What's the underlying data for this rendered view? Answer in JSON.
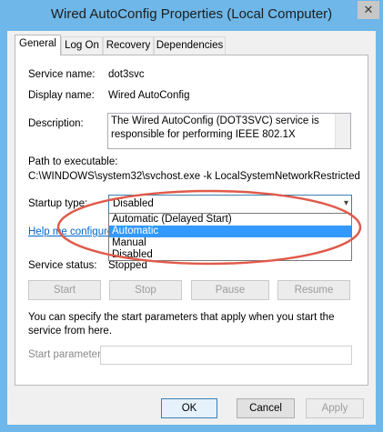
{
  "window": {
    "title": "Wired AutoConfig Properties (Local Computer)",
    "close_icon": "close-icon"
  },
  "tabs": [
    {
      "label": "General"
    },
    {
      "label": "Log On"
    },
    {
      "label": "Recovery"
    },
    {
      "label": "Dependencies"
    }
  ],
  "general": {
    "service_name_label": "Service name:",
    "service_name_value": "dot3svc",
    "display_name_label": "Display name:",
    "display_name_value": "Wired AutoConfig",
    "description_label": "Description:",
    "description_value": "The Wired AutoConfig (DOT3SVC) service is responsible for performing IEEE 802.1X",
    "path_label": "Path to executable:",
    "path_value": "C:\\WINDOWS\\system32\\svchost.exe -k LocalSystemNetworkRestricted",
    "startup_type_label": "Startup type:",
    "startup_type_value": "Disabled",
    "startup_options": [
      "Automatic (Delayed Start)",
      "Automatic",
      "Manual",
      "Disabled"
    ],
    "startup_selected_index": 1,
    "help_link": "Help me configure s",
    "service_status_label": "Service status:",
    "service_status_value": "Stopped",
    "buttons": {
      "start": "Start",
      "stop": "Stop",
      "pause": "Pause",
      "resume": "Resume"
    },
    "params_note": "You can specify the start parameters that apply when you start the service from here.",
    "start_params_label": "Start parameters:",
    "start_params_value": ""
  },
  "footer": {
    "ok": "OK",
    "cancel": "Cancel",
    "apply": "Apply"
  },
  "colors": {
    "title_bar": "#6eb7e8",
    "selection": "#3399ff",
    "annotation_oval": "#e05a4a",
    "link": "#0066cc"
  }
}
